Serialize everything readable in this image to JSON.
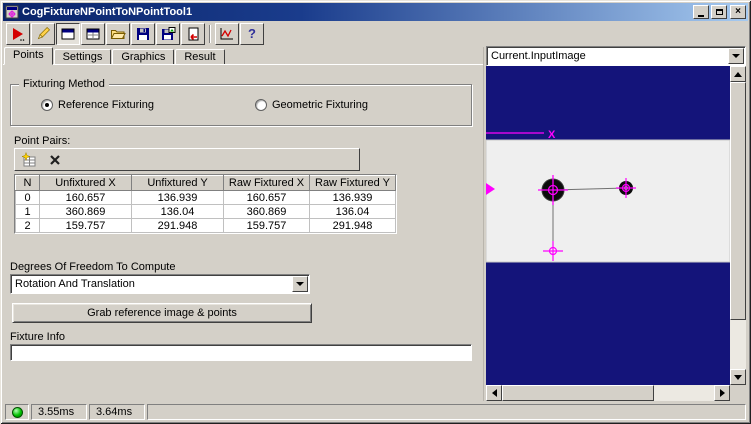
{
  "window": {
    "title": "CogFixtureNPointToNPointTool1",
    "controls": {
      "close": "×"
    }
  },
  "toolbar": {
    "buttons": [
      "run",
      "electric-edit",
      "floating-window",
      "docked-window",
      "open-file",
      "save-file",
      "save-image",
      "reset",
      "signal-graph",
      "help"
    ],
    "help_glyph": "?"
  },
  "tabs": {
    "items": [
      {
        "label": "Points",
        "active": true
      },
      {
        "label": "Settings",
        "active": false
      },
      {
        "label": "Graphics",
        "active": false
      },
      {
        "label": "Result",
        "active": false
      }
    ]
  },
  "fixturing": {
    "group_label": "Fixturing Method",
    "options": [
      {
        "label": "Reference Fixturing",
        "selected": true
      },
      {
        "label": "Geometric Fixturing",
        "selected": false
      }
    ]
  },
  "point_pairs": {
    "label": "Point Pairs:",
    "columns": [
      "N",
      "Unfixtured X",
      "Unfixtured Y",
      "Raw Fixtured X",
      "Raw Fixtured Y"
    ],
    "rows": [
      [
        "0",
        "160.657",
        "136.939",
        "160.657",
        "136.939"
      ],
      [
        "1",
        "360.869",
        "136.04",
        "360.869",
        "136.04"
      ],
      [
        "2",
        "159.757",
        "291.948",
        "159.757",
        "291.948"
      ]
    ]
  },
  "dof": {
    "label": "Degrees Of Freedom To Compute",
    "value": "Rotation And Translation"
  },
  "grab_button": {
    "label": "Grab reference image & points"
  },
  "fixture_info": {
    "label": "Fixture Info",
    "value": ""
  },
  "image_panel": {
    "source": "Current.InputImage",
    "axis_label": "X"
  },
  "status": {
    "time1": "3.55ms",
    "time2": "3.64ms"
  }
}
